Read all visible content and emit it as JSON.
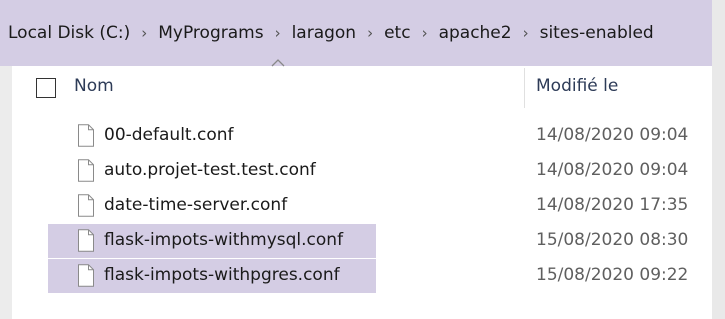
{
  "breadcrumb": {
    "items": [
      "Local Disk (C:)",
      "MyPrograms",
      "laragon",
      "etc",
      "apache2",
      "sites-enabled"
    ],
    "separator": "›"
  },
  "header": {
    "name_label": "Nom",
    "modified_label": "Modifié le"
  },
  "files": [
    {
      "name": "00-default.conf",
      "modified": "14/08/2020 09:04",
      "highlighted": false
    },
    {
      "name": "auto.projet-test.test.conf",
      "modified": "14/08/2020 09:04",
      "highlighted": false
    },
    {
      "name": "date-time-server.conf",
      "modified": "14/08/2020 17:35",
      "highlighted": false
    },
    {
      "name": "flask-impots-withmysql.conf",
      "modified": "15/08/2020 08:30",
      "highlighted": true
    },
    {
      "name": "flask-impots-withpgres.conf",
      "modified": "15/08/2020 09:22",
      "highlighted": true
    }
  ],
  "colors": {
    "highlight": "#d4cde4",
    "header_text": "#2d3b57",
    "date_text": "#5f5f5f"
  }
}
